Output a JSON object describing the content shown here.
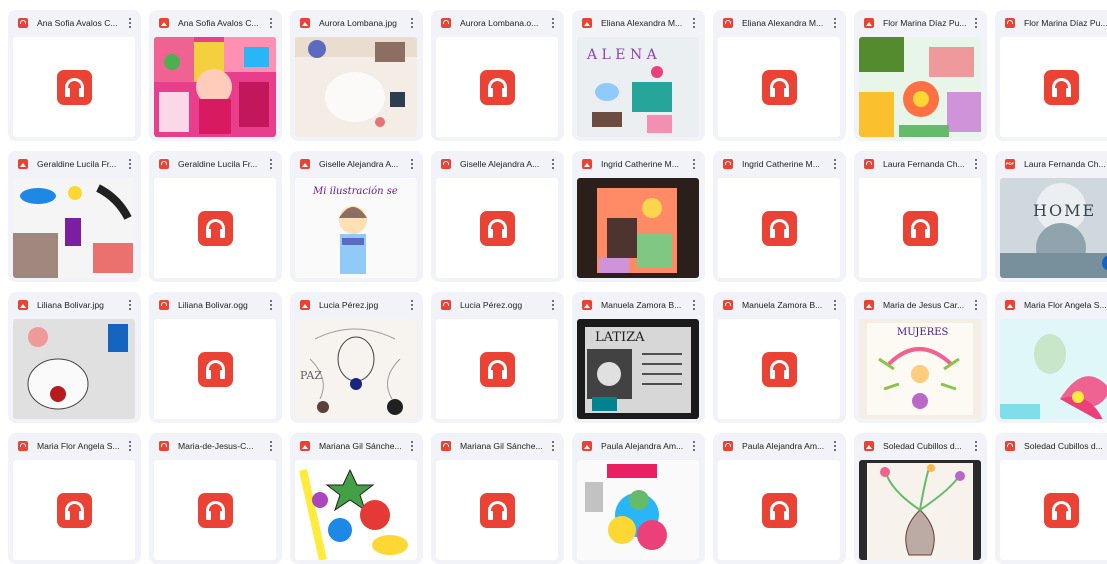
{
  "colors": {
    "audio_red": "#ea4335",
    "card_bg": "#f1f3f9",
    "title_text": "#1f1f1f"
  },
  "files": [
    {
      "name": "Ana Sofia Avalos C...",
      "type": "audio",
      "icon": "audio-file-icon"
    },
    {
      "name": "Ana Sofia Avalos C...",
      "type": "image",
      "icon": "image-file-icon",
      "thumb": "collage-pink"
    },
    {
      "name": "Aurora Lombana.jpg",
      "type": "image",
      "icon": "image-file-icon",
      "thumb": "collage-beige"
    },
    {
      "name": "Aurora Lombana.o...",
      "type": "audio",
      "icon": "audio-file-icon"
    },
    {
      "name": "Eliana Alexandra M...",
      "type": "image",
      "icon": "image-file-icon",
      "thumb": "collage-alena"
    },
    {
      "name": "Eliana Alexandra M...",
      "type": "audio",
      "icon": "audio-file-icon"
    },
    {
      "name": "Flor Marina Díaz Pu...",
      "type": "image",
      "icon": "image-file-icon",
      "thumb": "collage-green"
    },
    {
      "name": "Flor Marina Díaz Pu...",
      "type": "audio",
      "icon": "audio-file-icon"
    },
    {
      "name": "Geraldine Lucila Fr...",
      "type": "image",
      "icon": "image-file-icon",
      "thumb": "collage-white"
    },
    {
      "name": "Geraldine Lucila Fr...",
      "type": "audio",
      "icon": "audio-file-icon"
    },
    {
      "name": "Giselle Alejandra A...",
      "type": "image",
      "icon": "image-file-icon",
      "thumb": "drawing-pink"
    },
    {
      "name": "Giselle Alejandra A...",
      "type": "audio",
      "icon": "audio-file-icon"
    },
    {
      "name": "Ingrid Catherine M...",
      "type": "image",
      "icon": "image-file-icon",
      "thumb": "collage-orange"
    },
    {
      "name": "Ingrid Catherine M...",
      "type": "audio",
      "icon": "audio-file-icon"
    },
    {
      "name": "Laura Fernanda Ch...",
      "type": "audio",
      "icon": "audio-file-icon"
    },
    {
      "name": "Laura Fernanda Ch...",
      "type": "pdf",
      "icon": "pdf-file-icon",
      "thumb": "home-grey"
    },
    {
      "name": "Liliana Bolivar.jpg",
      "type": "image",
      "icon": "image-file-icon",
      "thumb": "collage-grey"
    },
    {
      "name": "Liliana Bolivar.ogg",
      "type": "audio",
      "icon": "audio-file-icon"
    },
    {
      "name": "Lucia Pérez.jpg",
      "type": "image",
      "icon": "image-file-icon",
      "thumb": "drawing-lines"
    },
    {
      "name": "Lucia Pérez.ogg",
      "type": "audio",
      "icon": "audio-file-icon"
    },
    {
      "name": "Manuela Zamora B...",
      "type": "image",
      "icon": "image-file-icon",
      "thumb": "collage-latiza"
    },
    {
      "name": "Manuela Zamora B...",
      "type": "audio",
      "icon": "audio-file-icon"
    },
    {
      "name": "Maria de Jesus Car...",
      "type": "image",
      "icon": "image-file-icon",
      "thumb": "drawing-fairy"
    },
    {
      "name": "Maria Flor Angela S...",
      "type": "image",
      "icon": "image-file-icon",
      "thumb": "painting-flower"
    },
    {
      "name": "Maria Flor Angela S...",
      "type": "audio",
      "icon": "audio-file-icon"
    },
    {
      "name": "Maria-de-Jesus-C...",
      "type": "audio",
      "icon": "audio-file-icon"
    },
    {
      "name": "Mariana Gil Sánche...",
      "type": "image",
      "icon": "image-file-icon",
      "thumb": "drawing-colorful"
    },
    {
      "name": "Mariana Gil Sánche...",
      "type": "audio",
      "icon": "audio-file-icon"
    },
    {
      "name": "Paula Alejandra Am...",
      "type": "image",
      "icon": "image-file-icon",
      "thumb": "poster-rainbow"
    },
    {
      "name": "Paula Alejandra Am...",
      "type": "audio",
      "icon": "audio-file-icon"
    },
    {
      "name": "Soledad Cubillos d...",
      "type": "image",
      "icon": "image-file-icon",
      "thumb": "drawing-vase"
    },
    {
      "name": "Soledad Cubillos d...",
      "type": "audio",
      "icon": "audio-file-icon"
    }
  ],
  "thumb_texts": {
    "alena": "A L E N A",
    "home": "HOME",
    "giselle": "Mi ilustración se",
    "latiza": "LATIZA",
    "paz": "PAZ",
    "mujeres": "MUJERES"
  }
}
